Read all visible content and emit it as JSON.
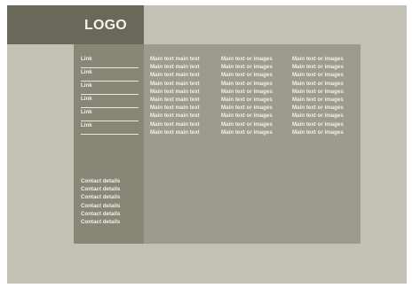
{
  "header": {
    "logo": "LOGO"
  },
  "sidebar": {
    "links": [
      {
        "label": "Link"
      },
      {
        "label": "Link"
      },
      {
        "label": "Link"
      },
      {
        "label": "Link"
      },
      {
        "label": "Link"
      },
      {
        "label": "Link"
      }
    ],
    "contact": [
      "Contact details",
      "Contact details",
      "Contact details",
      "Contact details",
      "Contact details",
      "Contact details"
    ]
  },
  "main": {
    "columns": [
      [
        "Main text main text",
        "Main text main text",
        "Main text main text",
        "Main text main text",
        "Main text main text",
        "Main text main text",
        "Main text main text",
        "Main text main text",
        "Main text main text",
        "Main text main text"
      ],
      [
        "Main text or images",
        "Main text or images",
        "Main text or images",
        "Main text or images",
        "Main text or images",
        "Main text or images",
        "Main text or images",
        "Main text or images",
        "Main text or images",
        "Main text or images"
      ],
      [
        "Main text or images",
        "Main text or images",
        "Main text or images",
        "Main text or images",
        "Main text or images",
        "Main text or images",
        "Main text or images",
        "Main text or images",
        "Main text or images",
        "Main text or images"
      ]
    ]
  },
  "colors": {
    "background": "#c2c1b3",
    "header": "#6a6858",
    "sidebar": "#888675",
    "main": "#9d9b8b",
    "text": "#f2f1ea"
  }
}
